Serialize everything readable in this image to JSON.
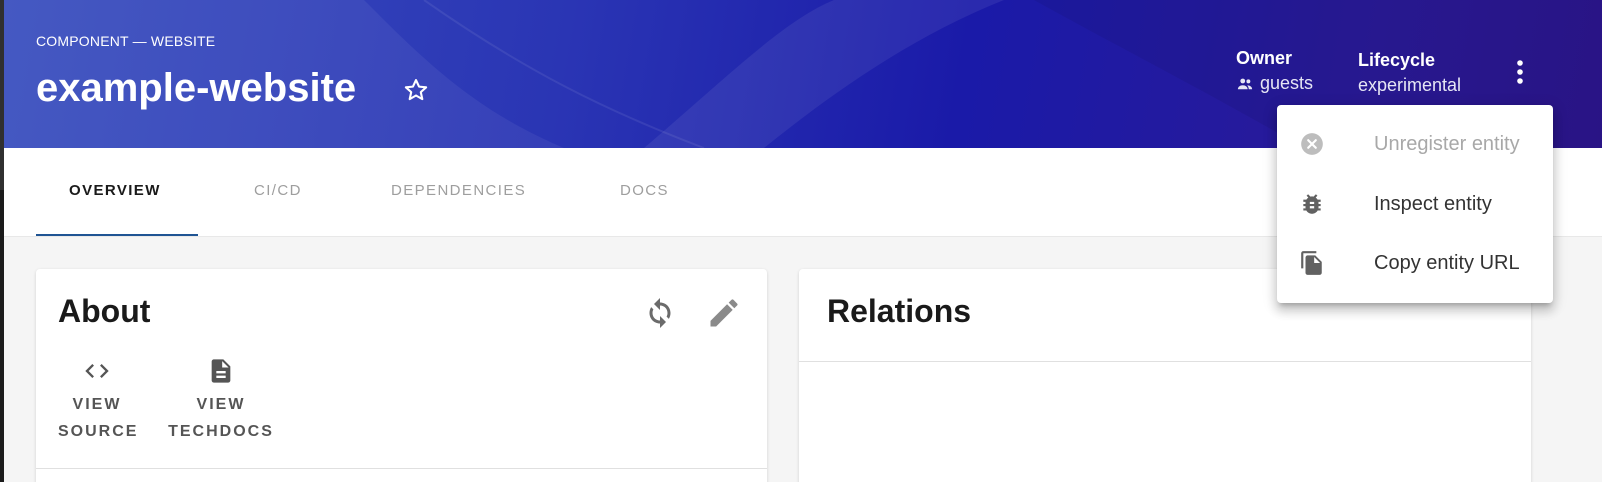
{
  "header": {
    "eyebrow": "COMPONENT — WEBSITE",
    "title": "example-website",
    "owner": {
      "label": "Owner",
      "value": "guests"
    },
    "lifecycle": {
      "label": "Lifecycle",
      "value": "experimental"
    },
    "colors": {
      "gradient_start": "#3a4fbf",
      "gradient_end": "#2c168e"
    }
  },
  "tabs": [
    {
      "label": "OVERVIEW",
      "active": true
    },
    {
      "label": "CI/CD",
      "active": false
    },
    {
      "label": "DEPENDENCIES",
      "active": false
    },
    {
      "label": "DOCS",
      "active": false
    }
  ],
  "about": {
    "title": "About",
    "links": [
      {
        "line1": "VIEW",
        "line2": "SOURCE",
        "icon": "code-icon"
      },
      {
        "line1": "VIEW",
        "line2": "TECHDOCS",
        "icon": "document-icon"
      }
    ]
  },
  "relations": {
    "title": "Relations"
  },
  "menu": {
    "items": [
      {
        "label": "Unregister entity",
        "icon": "cancel-circle-icon",
        "disabled": true
      },
      {
        "label": "Inspect entity",
        "icon": "bug-icon",
        "disabled": false
      },
      {
        "label": "Copy entity URL",
        "icon": "copy-icon",
        "disabled": false
      }
    ]
  },
  "accent_color": "#1f5493"
}
